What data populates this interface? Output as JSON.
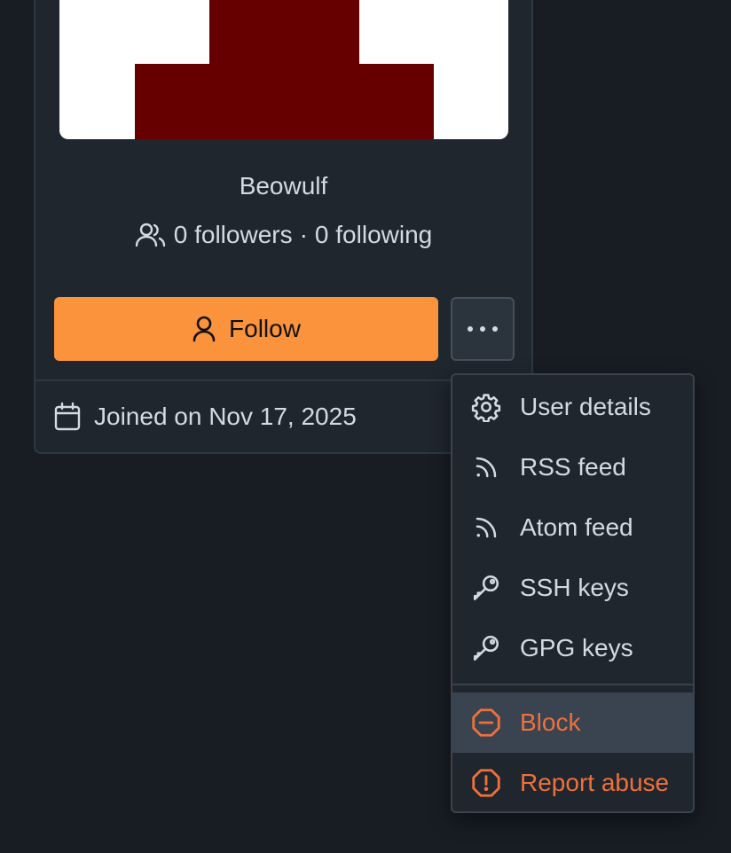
{
  "profile": {
    "username": "Beowulf",
    "followers_text": "0 followers",
    "separator": "·",
    "following_text": "0 following",
    "joined_text": "Joined on Nov 17, 2025"
  },
  "actions": {
    "follow_label": "Follow",
    "more_icon": "kebab-horizontal-icon"
  },
  "menu": {
    "items": [
      {
        "label": "User details",
        "icon": "gear-icon"
      },
      {
        "label": "RSS feed",
        "icon": "rss-icon"
      },
      {
        "label": "Atom feed",
        "icon": "rss-icon"
      },
      {
        "label": "SSH keys",
        "icon": "key-icon"
      },
      {
        "label": "GPG keys",
        "icon": "key-icon"
      },
      {
        "label": "Block",
        "icon": "blocked-icon"
      },
      {
        "label": "Report abuse",
        "icon": "report-icon"
      }
    ]
  },
  "colors": {
    "accent": "#fb923c",
    "danger": "#f0703a",
    "avatar_primary": "#660000",
    "background": "#181d24"
  }
}
